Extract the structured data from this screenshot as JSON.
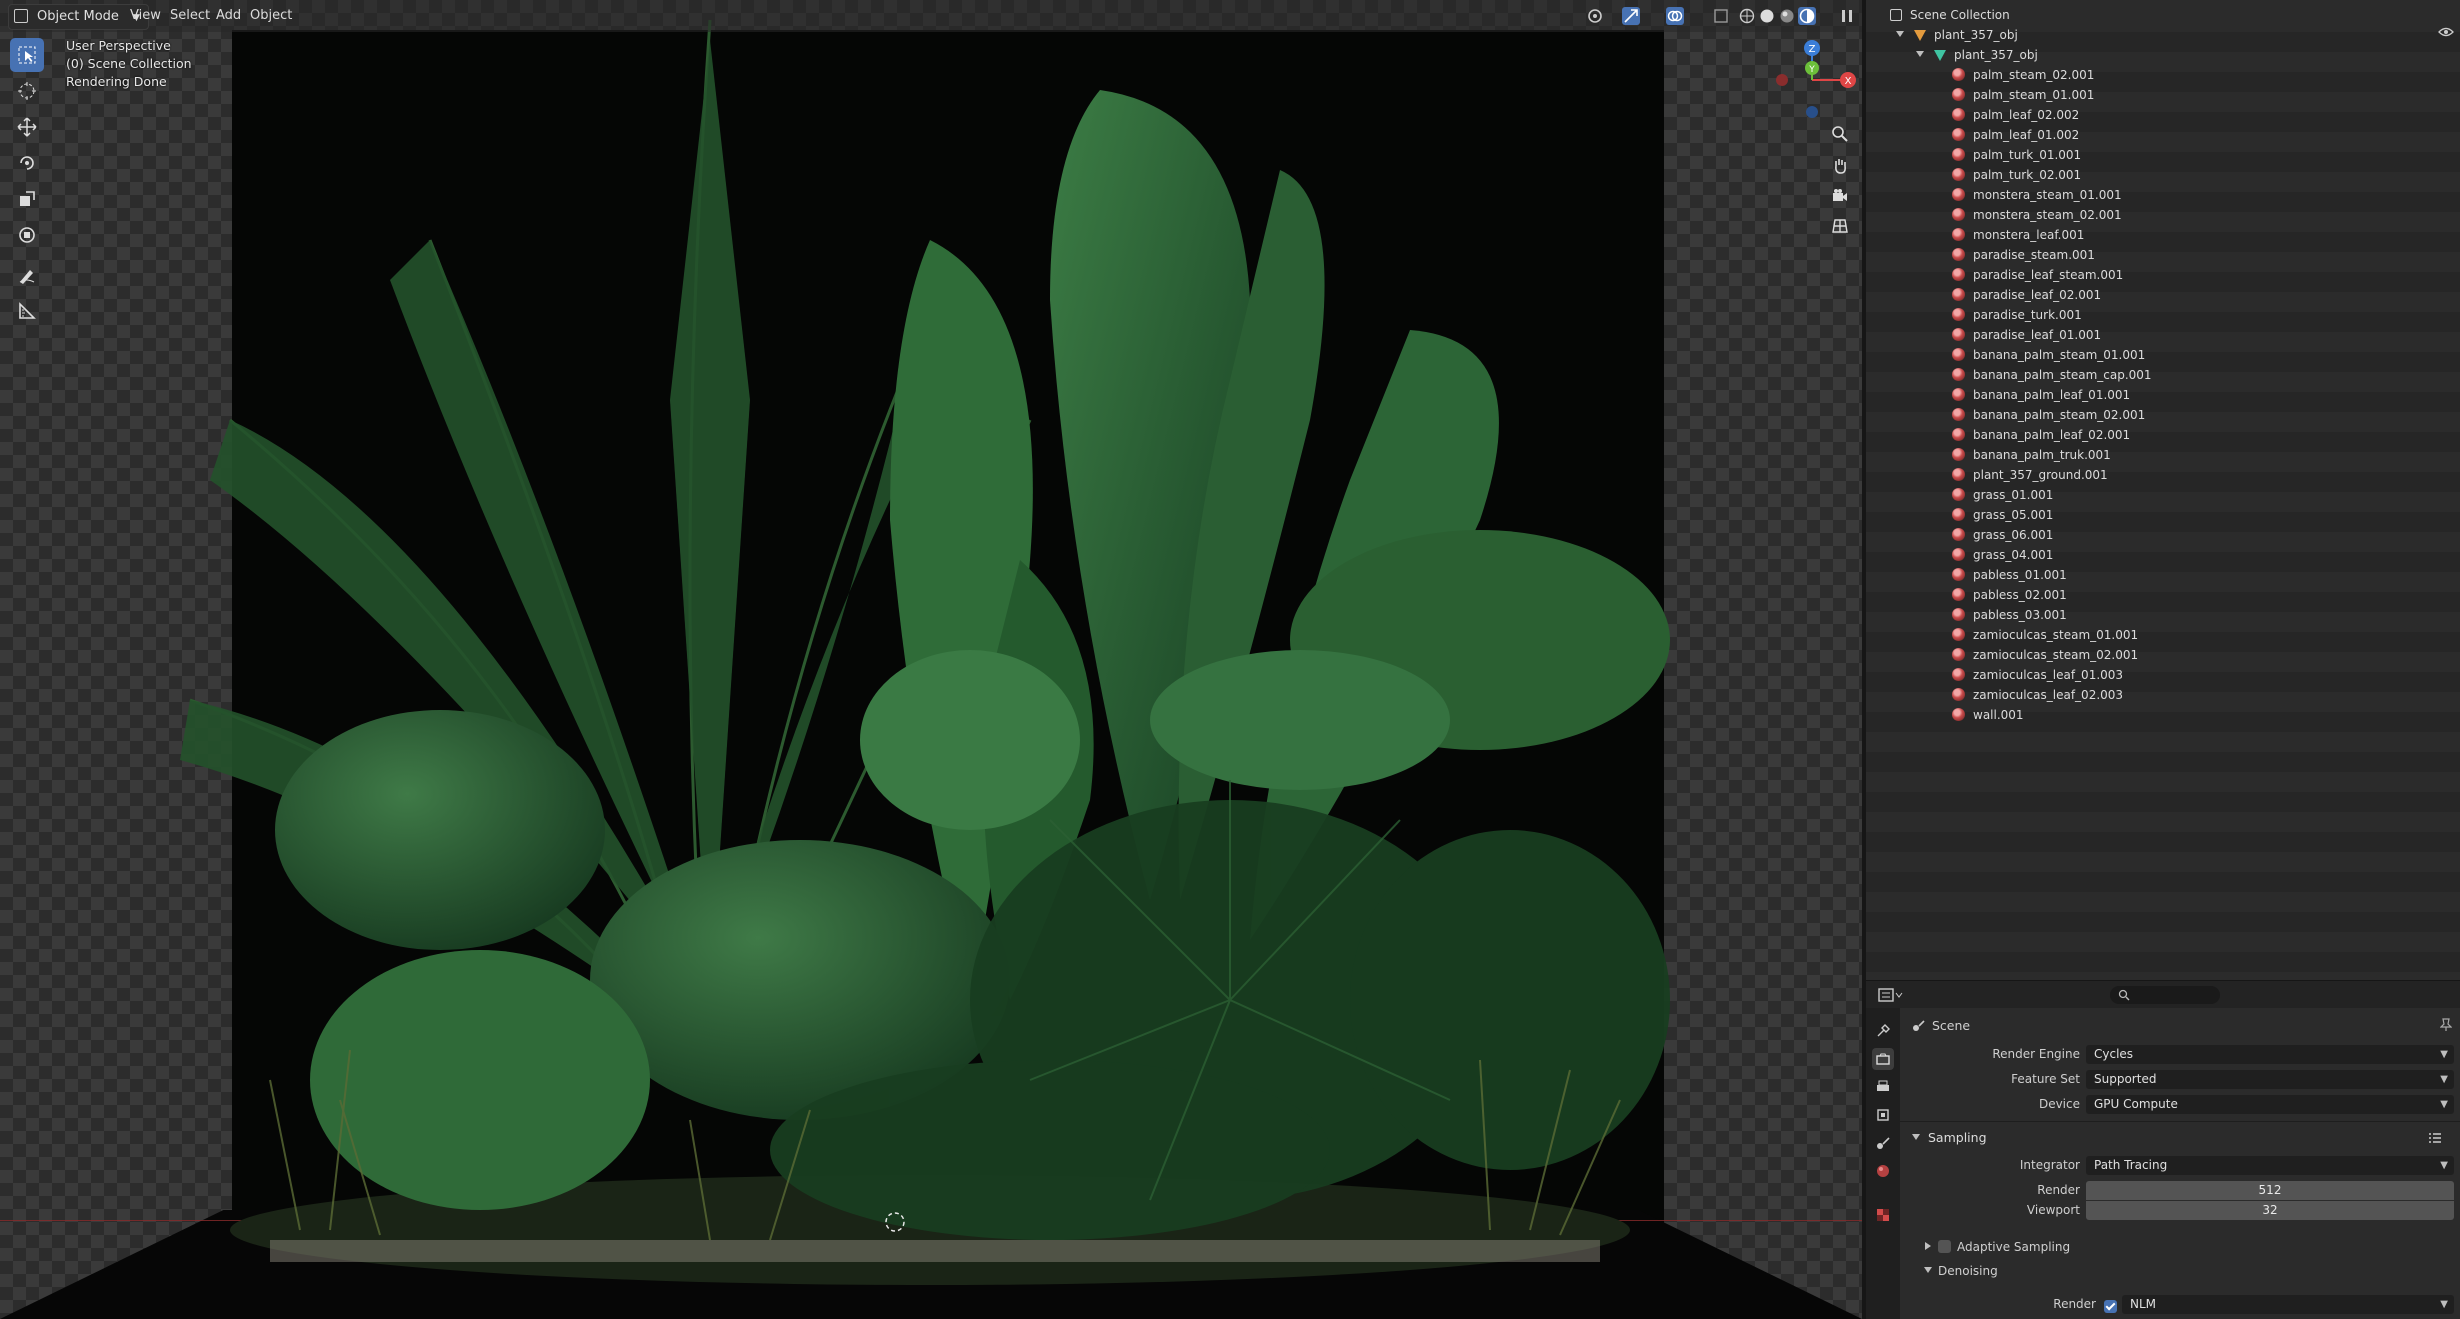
{
  "viewport": {
    "header": {
      "mode": "Object Mode",
      "menus": [
        "View",
        "Select",
        "Add",
        "Object"
      ]
    },
    "overlay": {
      "line1": "User Perspective",
      "line2": "(0) Scene Collection",
      "line3": "Rendering Done"
    },
    "tools": [
      "select-box-icon",
      "cursor-icon",
      "move-icon",
      "rotate-icon",
      "scale-icon",
      "transform-icon",
      "annotate-icon",
      "measure-icon"
    ],
    "gizmo": {
      "z_label": "Z",
      "y_label": "Y",
      "x_label": "X"
    },
    "nav_buttons": [
      "zoom-icon",
      "pan-hand-icon",
      "camera-icon",
      "grid-view-icon"
    ]
  },
  "outliner": {
    "root": "Scene Collection",
    "collection": "plant_357_obj",
    "object": "plant_357_obj",
    "materials": [
      "palm_steam_02.001",
      "palm_steam_01.001",
      "palm_leaf_02.002",
      "palm_leaf_01.002",
      "palm_turk_01.001",
      "palm_turk_02.001",
      "monstera_steam_01.001",
      "monstera_steam_02.001",
      "monstera_leaf.001",
      "paradise_steam.001",
      "paradise_leaf_steam.001",
      "paradise_leaf_02.001",
      "paradise_turk.001",
      "paradise_leaf_01.001",
      "banana_palm_steam_01.001",
      "banana_palm_steam_cap.001",
      "banana_palm_leaf_01.001",
      "banana_palm_steam_02.001",
      "banana_palm_leaf_02.001",
      "banana_palm_truk.001",
      "plant_357_ground.001",
      "grass_01.001",
      "grass_05.001",
      "grass_06.001",
      "grass_04.001",
      "pabless_01.001",
      "pabless_02.001",
      "pabless_03.001",
      "zamioculcas_steam_01.001",
      "zamioculcas_steam_02.001",
      "zamioculcas_leaf_01.003",
      "zamioculcas_leaf_02.003",
      "wall.001"
    ]
  },
  "properties": {
    "search_placeholder": "",
    "context": "Scene",
    "render_engine_label": "Render Engine",
    "render_engine": "Cycles",
    "feature_set_label": "Feature Set",
    "feature_set": "Supported",
    "device_label": "Device",
    "device": "GPU Compute",
    "sampling": {
      "title": "Sampling",
      "integrator_label": "Integrator",
      "integrator": "Path Tracing",
      "render_label": "Render",
      "render_value": "512",
      "viewport_label": "Viewport",
      "viewport_value": "32",
      "adaptive_label": "Adaptive Sampling",
      "denoising_label": "Denoising",
      "denoise_render_label": "Render",
      "denoiser": "NLM"
    }
  },
  "colors": {
    "accent": "#4772b3",
    "axis_x": "#e04646",
    "axis_y": "#6cbf3a",
    "axis_z": "#3b7ed8"
  }
}
